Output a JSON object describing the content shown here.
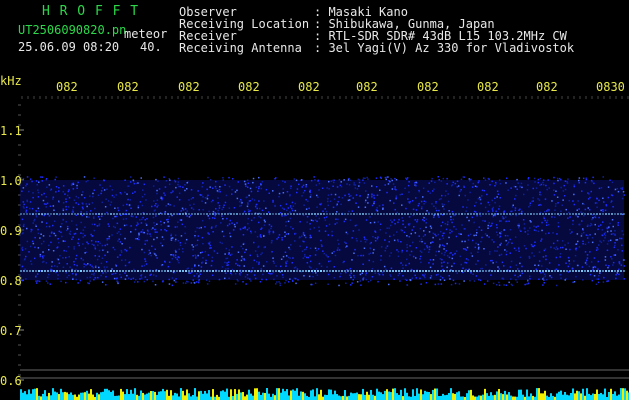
{
  "header": {
    "program": "H R O F F T",
    "filename": "UT2506090820.pn",
    "mode": "meteor",
    "datetime": "25.06.09 08:20",
    "gain": "40.",
    "fields": [
      {
        "label": "Observer",
        "value": ": Masaki Kano"
      },
      {
        "label": "Receiving Location",
        "value": ": Shibukawa, Gunma, Japan"
      },
      {
        "label": "Receiver",
        "value": ": RTL-SDR SDR# 43dB L15 103.2MHz CW"
      },
      {
        "label": "Receiving Antenna",
        "value": ": 3el Yagi(V) Az 330 for Vladivostok"
      }
    ]
  },
  "axis": {
    "unit": "kHz",
    "y_labels": [
      "1.1",
      "1.0",
      "0.9",
      "0.8",
      "0.7",
      "0.6"
    ],
    "time_ticks": [
      "082",
      "082",
      "082",
      "082",
      "082",
      "082",
      "082",
      "082",
      "082",
      "0830"
    ]
  },
  "colors": {
    "background": "#000000",
    "label_green": "#2bd84a",
    "label_yellow": "#e8e84a",
    "noise_blue": "#1c2bff",
    "signal_cyan": "#7fd0ff",
    "baseline_yellow": "#f0f000",
    "baseline_cyan": "#00d8ff"
  }
}
